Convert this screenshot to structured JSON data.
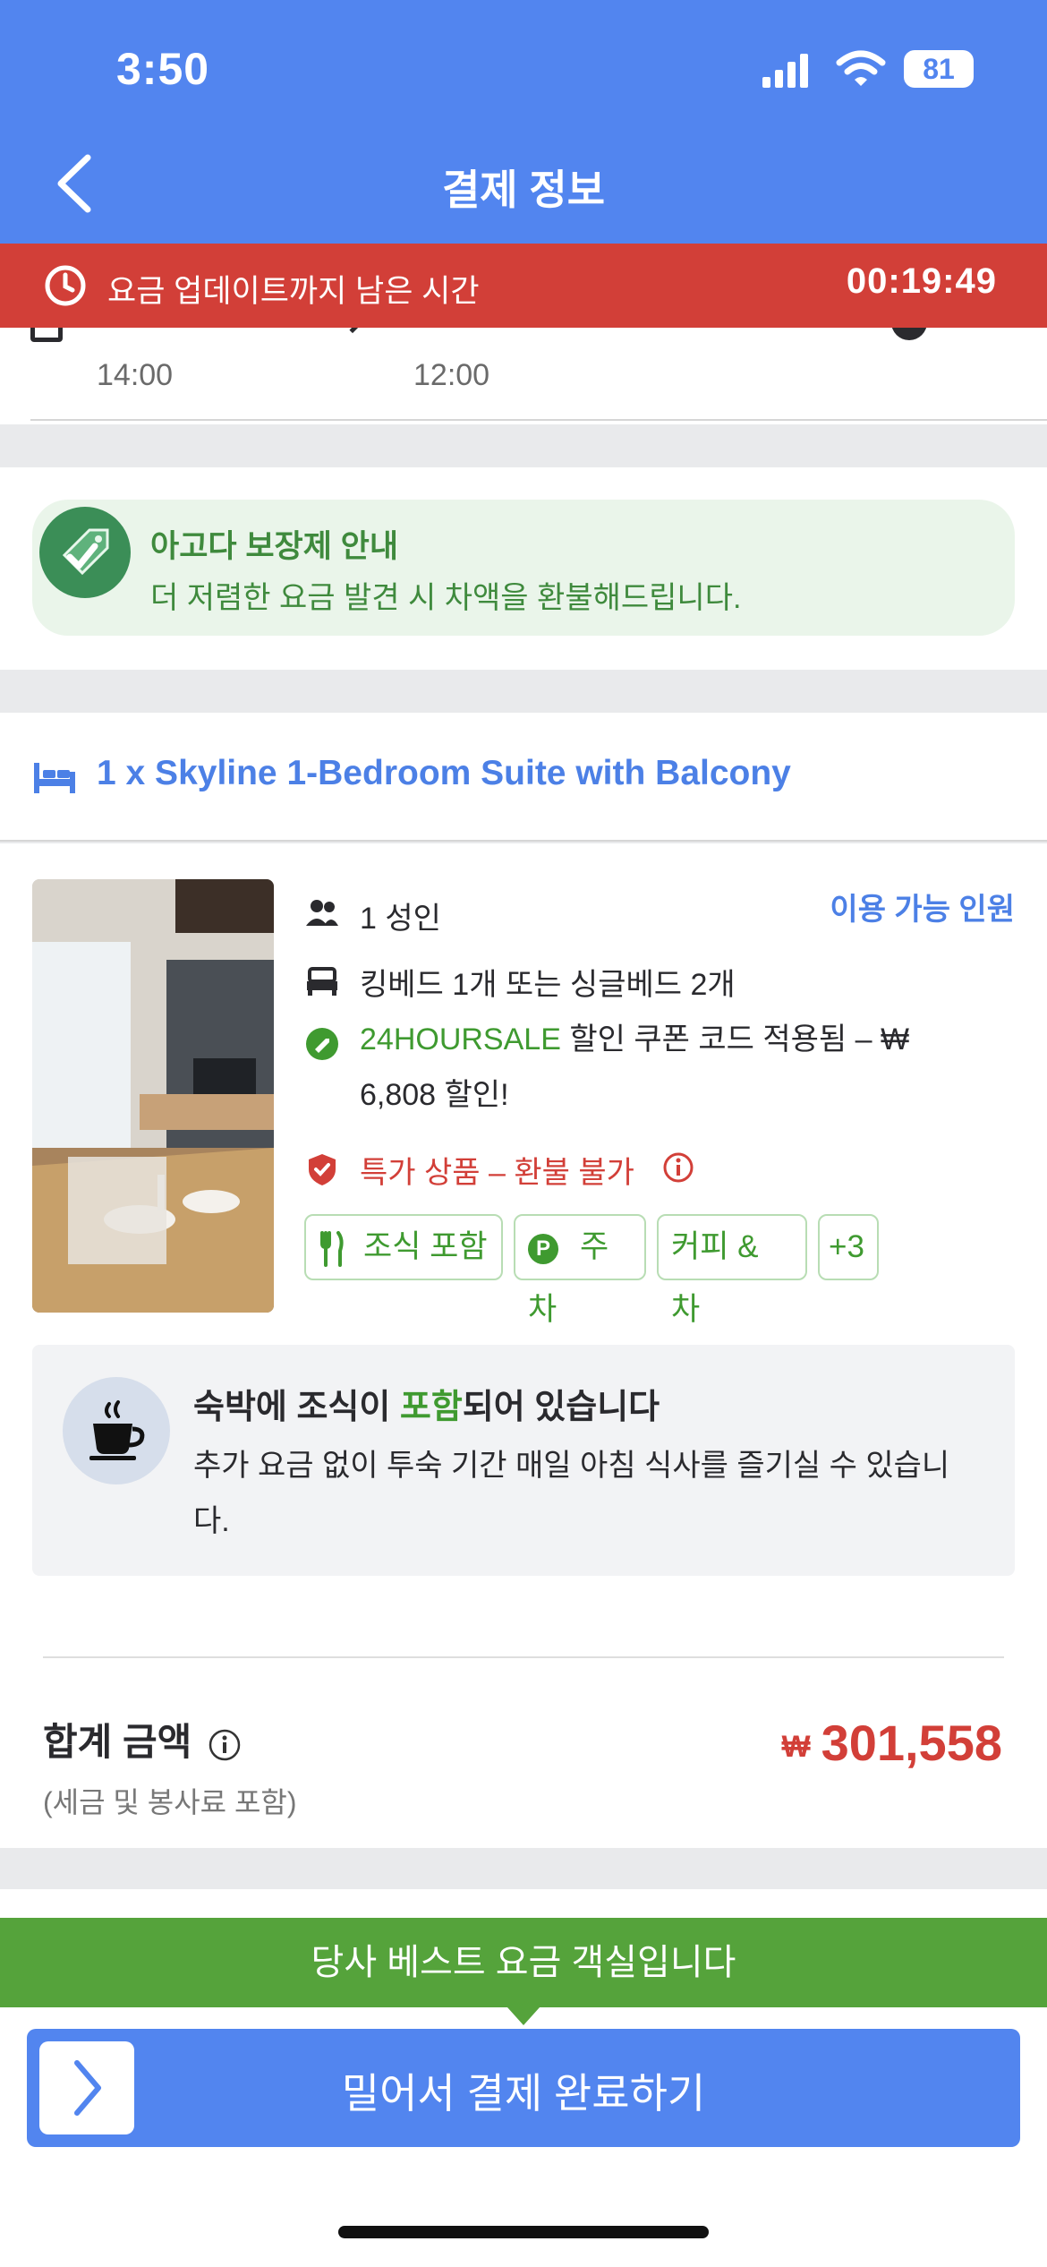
{
  "status_bar": {
    "time": "3:50",
    "battery": "81"
  },
  "header": {
    "title": "결제 정보"
  },
  "timer": {
    "label": "요금 업데이트까지 남은 시간",
    "countdown": "00:19:49"
  },
  "stay": {
    "checkin_time": "14:00",
    "checkout_time": "12:00"
  },
  "guarantee": {
    "title": "아고다 보장제 안내",
    "subtitle": "더 저렴한 요금 발견 시 차액을 환불해드립니다."
  },
  "room": {
    "title": "1 x Skyline 1-Bedroom Suite with Balcony",
    "occupancy": "1 성인",
    "available_link": "이용 가능 인원",
    "beds": "킹베드 1개 또는 싱글베드 2개",
    "coupon_code": "24HOURSALE",
    "coupon_text_1": " 할인 쿠폰 코드 적용됨 – ₩",
    "coupon_text_2": "6,808 할인!",
    "refund": "특가 상품 – 환불 불가",
    "chips": [
      "조식 포함",
      "주차",
      "커피 & 차",
      "+3"
    ]
  },
  "breakfast": {
    "title_pre": "숙박에 조식이 ",
    "title_highlight": "포함",
    "title_post": "되어 있습니다",
    "subtitle": "추가 요금 없이 투숙 기간 매일 아침 식사를 즐기실 수 있습니다."
  },
  "total": {
    "label": "합계 금액",
    "note": "(세금 및 봉사료 포함)",
    "currency": "₩",
    "amount": "301,558"
  },
  "footer": {
    "best_rate": "당사 베스트 요금 객실입니다",
    "pay_button": "밀어서 결제 완료하기"
  },
  "colors": {
    "brand": "#5285ef",
    "alert": "#d23f38",
    "success": "#55a33b"
  }
}
